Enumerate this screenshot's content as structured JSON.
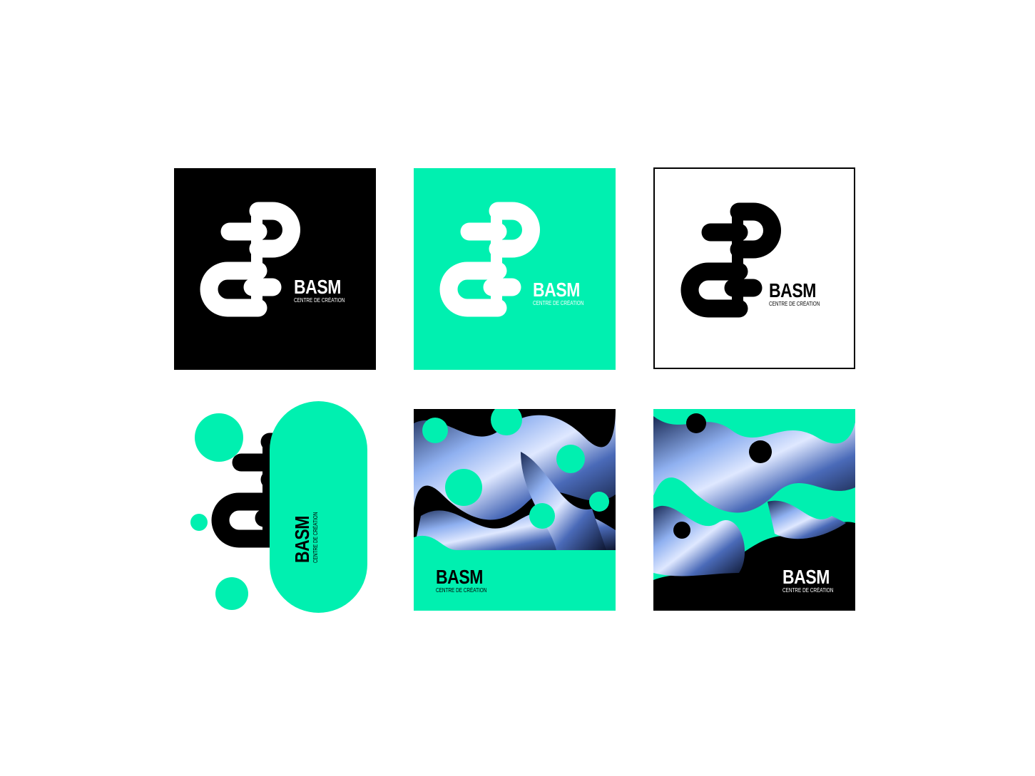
{
  "brand": {
    "name": "BASM",
    "tagline": "CENTRE DE CRÉATION"
  },
  "colors": {
    "mint": "#00f0b0",
    "black": "#000000",
    "white": "#ffffff",
    "chrome_blue": "#7f9fe0"
  },
  "variants": [
    {
      "label": "white logo on black"
    },
    {
      "label": "white logo on mint"
    },
    {
      "label": "black logo on white"
    },
    {
      "label": "black logo on mint capsule with dots"
    },
    {
      "label": "chrome pattern with mint band"
    },
    {
      "label": "chrome pattern on black"
    }
  ]
}
